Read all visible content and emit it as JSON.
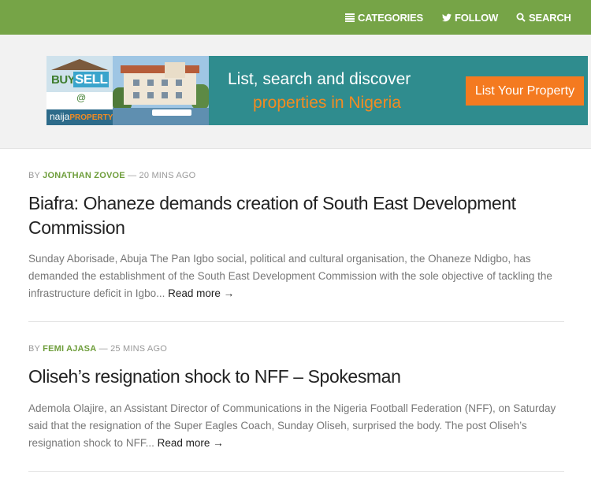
{
  "nav": {
    "categories_label": "CATEGORIES",
    "follow_label": "FOLLOW",
    "search_label": "SEARCH",
    "bar_color": "#76a447",
    "icons": [
      "list-icon",
      "twitter-bird-icon",
      "search-icon"
    ]
  },
  "banner": {
    "logo_buy": "BUY",
    "logo_sell": "SELL",
    "logo_at": "@",
    "logo_naija": "naija",
    "logo_property": "PROPERTY",
    "line1": "List, search and discover",
    "line2": "properties in Nigeria",
    "button_label": "List Your Property",
    "bg_color": "#2f8c8e",
    "accent_color": "#f47a20"
  },
  "articles": [
    {
      "by": "BY",
      "author": "JONATHAN ZOVOE",
      "time": "— 20 MINS AGO",
      "title": "Biafra: Ohaneze demands creation of South East Development Commission",
      "excerpt": "Sunday Aborisade, Abuja The Pan Igbo social, political and cultural organisation, the Ohaneze Ndigbo, has demanded the establishment of the South East Development Commission with the sole objective of tackling the infrastructure deficit in Igbo...",
      "more": "Read more →"
    },
    {
      "by": "BY",
      "author": "FEMI AJASA",
      "time": "— 25 MINS AGO",
      "title": "Oliseh’s resignation shock to NFF – Spokesman",
      "excerpt": "Ademola Olajire, an Assistant Director of Communications in the Nigeria Football Federation (NFF), on Saturday said that the resignation of the Super Eagles Coach, Sunday Oliseh, surprised the body. The post Oliseh’s resignation shock to NFF...",
      "more": "Read more →"
    }
  ]
}
